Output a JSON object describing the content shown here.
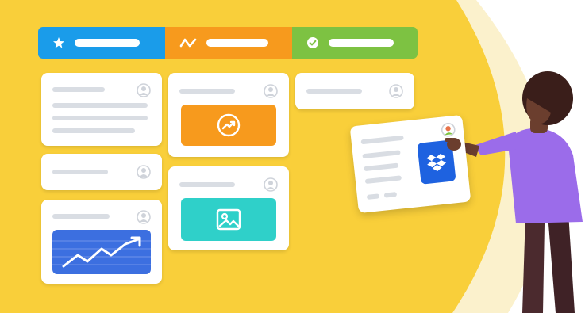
{
  "colors": {
    "background_yellow": "#F9CF3A",
    "header_blue": "#1A9CEA",
    "header_orange": "#F79A1D",
    "header_green": "#7DC242",
    "tile_orange": "#F79A1D",
    "tile_teal": "#2FD0C9",
    "chart_blue": "#3C6FE0",
    "dropbox_blue": "#1E62E0",
    "shirt_purple": "#9B6CEA",
    "card_white": "#FFFFFF",
    "line_gray": "#D9DDE3"
  },
  "board": {
    "columns": [
      {
        "icon": "star-icon"
      },
      {
        "icon": "activity-wave-icon"
      },
      {
        "icon": "check-circle-icon"
      }
    ],
    "tiles": [
      {
        "icon": "trend-up-circle-icon"
      },
      {
        "icon": "image-icon"
      },
      {
        "icon": "growth-chart-icon"
      }
    ]
  },
  "dragged_card": {
    "icon": "dropbox-icon"
  },
  "illustration": {
    "subject": "person-illustration"
  }
}
